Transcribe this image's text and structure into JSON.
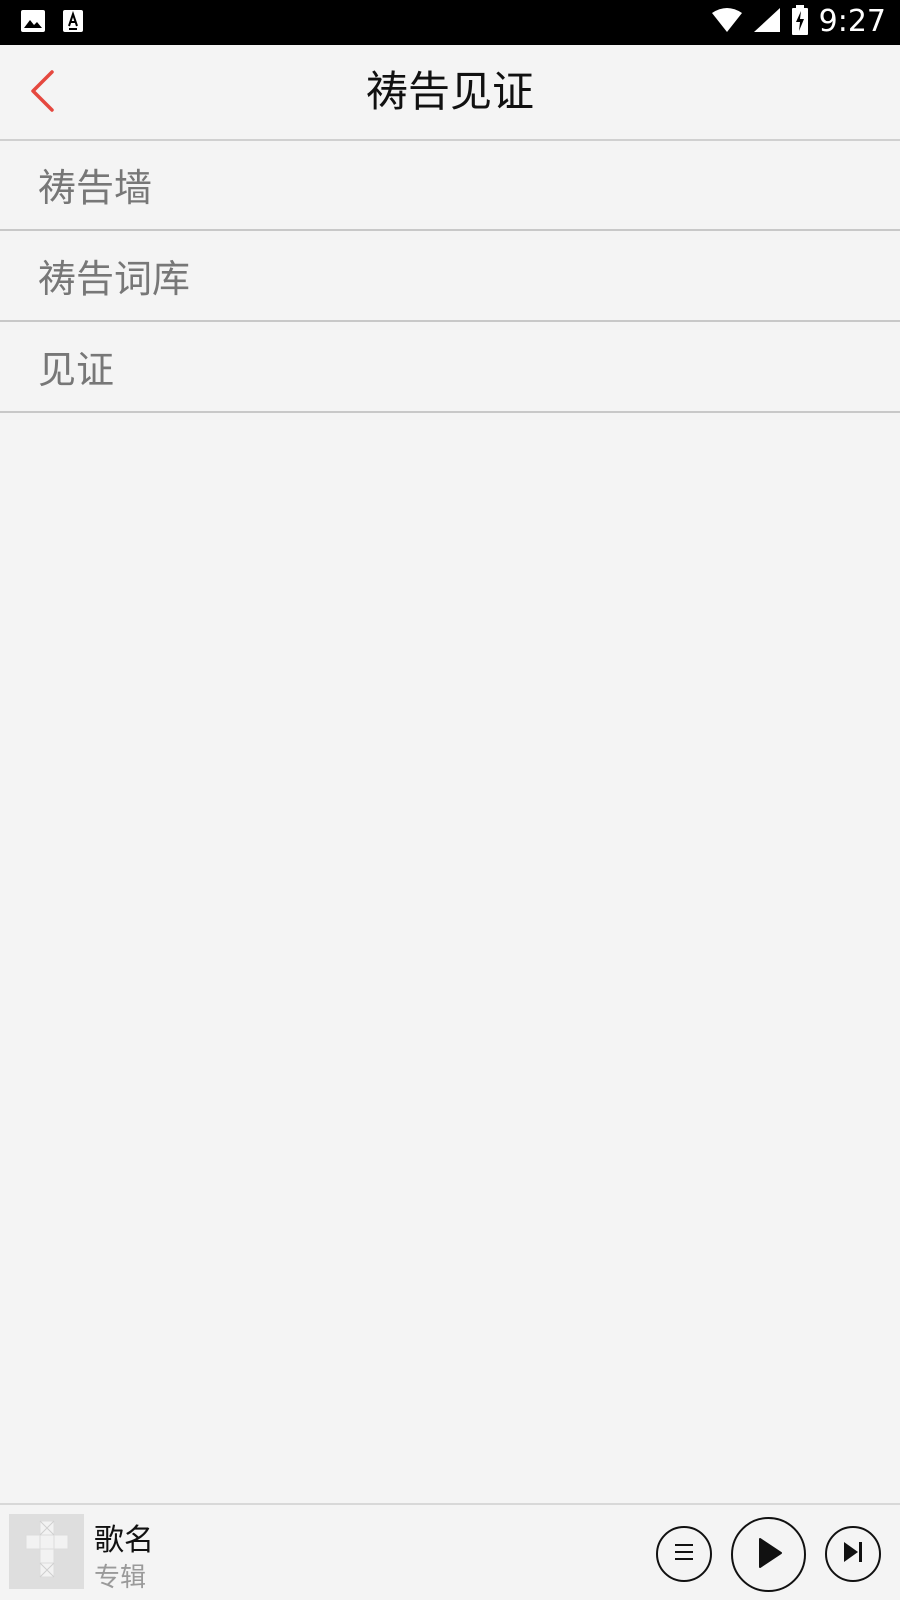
{
  "status_bar": {
    "time": "9:27",
    "icons": [
      "image-icon",
      "accessibility-icon",
      "wifi-icon",
      "signal-icon",
      "battery-charging-icon"
    ]
  },
  "header": {
    "title": "祷告见证",
    "back_icon": "chevron-left-icon",
    "accent_color": "#e5483f"
  },
  "menu": {
    "items": [
      {
        "label": "祷告墙"
      },
      {
        "label": "祷告词库"
      },
      {
        "label": "见证"
      }
    ]
  },
  "player": {
    "song_title": "歌名",
    "album": "专辑",
    "controls": [
      "playlist-icon",
      "play-icon",
      "skip-next-icon"
    ]
  }
}
